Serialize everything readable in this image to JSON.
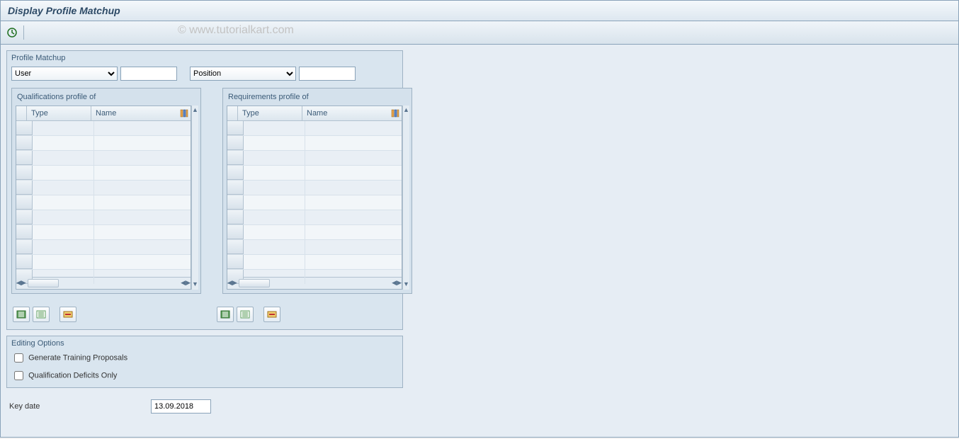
{
  "title": "Display Profile Matchup",
  "watermark": "© www.tutorialkart.com",
  "profile_matchup": {
    "section": "Profile Matchup",
    "left_select": "User",
    "left_input": "",
    "right_select": "Position",
    "right_input": "",
    "qualifications": {
      "title": "Qualifications profile of",
      "col_type": "Type",
      "col_name": "Name"
    },
    "requirements": {
      "title": "Requirements profile of",
      "col_type": "Type",
      "col_name": "Name"
    }
  },
  "editing": {
    "section": "Editing Options",
    "opt1": "Generate Training Proposals",
    "opt2": "Qualification Deficits Only"
  },
  "key_date": {
    "label": "Key date",
    "value": "13.09.2018"
  }
}
